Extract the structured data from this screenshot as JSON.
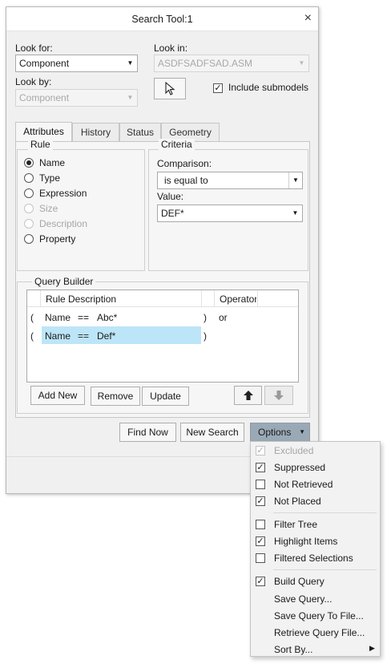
{
  "window": {
    "title": "Search Tool:1",
    "close_glyph": "×"
  },
  "look_for": {
    "label": "Look for:",
    "value": "Component"
  },
  "look_by": {
    "label": "Look by:",
    "value": "Component"
  },
  "look_in": {
    "label": "Look in:",
    "value": "ASDFSADFSAD.ASM"
  },
  "include_submodels": {
    "label": "Include submodels",
    "checked": true
  },
  "tabs": [
    "Attributes",
    "History",
    "Status",
    "Geometry"
  ],
  "rule": {
    "title": "Rule",
    "options": [
      {
        "label": "Name",
        "checked": true,
        "enabled": true
      },
      {
        "label": "Type",
        "checked": false,
        "enabled": true
      },
      {
        "label": "Expression",
        "checked": false,
        "enabled": true
      },
      {
        "label": "Size",
        "checked": false,
        "enabled": false
      },
      {
        "label": "Description",
        "checked": false,
        "enabled": false
      },
      {
        "label": "Property",
        "checked": false,
        "enabled": true
      }
    ]
  },
  "criteria": {
    "title": "Criteria",
    "comparison_label": "Comparison:",
    "comparison_value": "is equal to",
    "value_label": "Value:",
    "value_value": "DEF*"
  },
  "query_builder": {
    "title": "Query Builder",
    "columns": [
      "Rule Description",
      "Operator"
    ],
    "rows": [
      {
        "open": "(",
        "field": "Name",
        "op": "==",
        "value": "Abc*",
        "close": ")",
        "operator": "or",
        "selected": false
      },
      {
        "open": "(",
        "field": "Name",
        "op": "==",
        "value": "Def*",
        "close": ")",
        "operator": "",
        "selected": true
      }
    ],
    "buttons": {
      "add_new": "Add New",
      "remove": "Remove",
      "update": "Update"
    }
  },
  "footer": {
    "find_now": "Find Now",
    "new_search": "New Search",
    "options": "Options"
  },
  "options_menu": {
    "group1": [
      {
        "label": "Excluded",
        "checked": true,
        "enabled": false
      },
      {
        "label": "Suppressed",
        "checked": true,
        "enabled": true
      },
      {
        "label": "Not Retrieved",
        "checked": false,
        "enabled": true
      },
      {
        "label": "Not Placed",
        "checked": true,
        "enabled": true
      }
    ],
    "group2": [
      {
        "label": "Filter Tree",
        "checked": false,
        "enabled": true
      },
      {
        "label": "Highlight Items",
        "checked": true,
        "enabled": true
      },
      {
        "label": "Filtered Selections",
        "checked": false,
        "enabled": true
      }
    ],
    "group3": [
      {
        "label": "Build Query",
        "checked": true,
        "enabled": true
      }
    ],
    "actions": [
      "Save Query...",
      "Save Query To File...",
      "Retrieve Query File...",
      "Sort By..."
    ]
  },
  "colors": {
    "selection": "#bde5f8",
    "dialog_bg": "#f0f0f0",
    "menu_hover": "#9aa9b6"
  }
}
